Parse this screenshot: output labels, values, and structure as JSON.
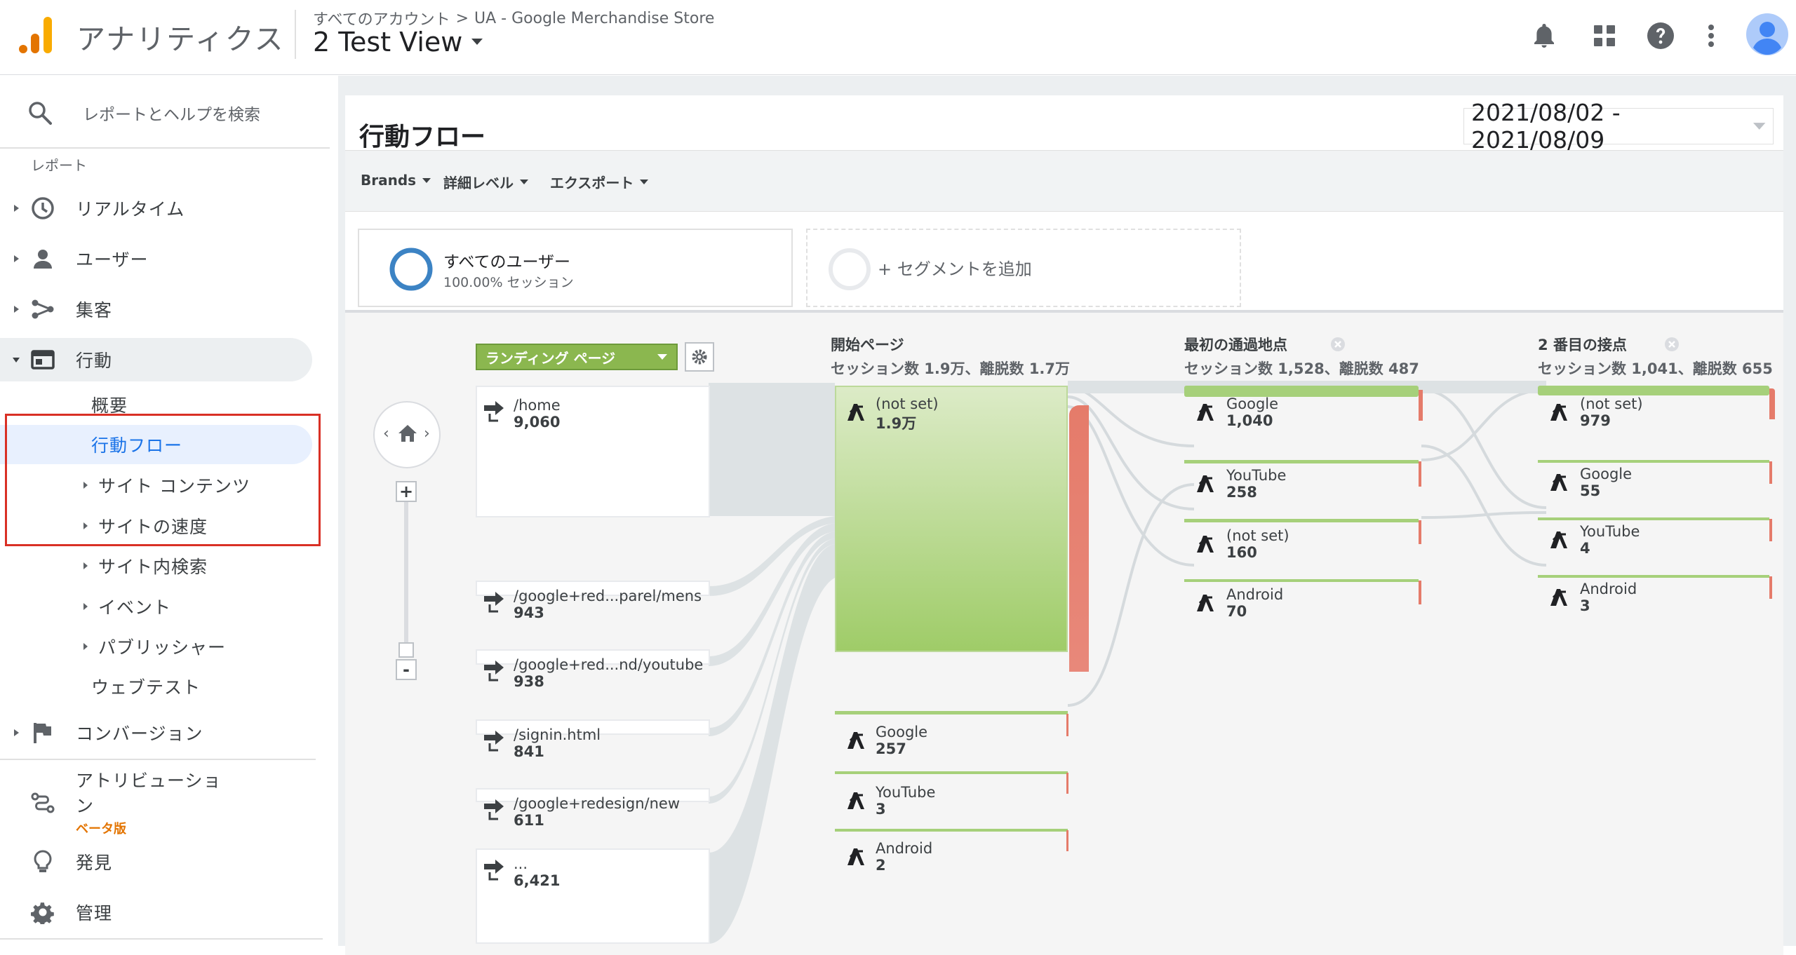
{
  "header": {
    "app_title": "アナリティクス",
    "breadcrumb_root": "すべてのアカウント",
    "breadcrumb_sep": ">",
    "breadcrumb_property": "UA - Google Merchandise Store",
    "view_title": "2 Test View"
  },
  "sidebar": {
    "search_placeholder": "レポートとヘルプを検索",
    "reports_header": "レポート",
    "items": [
      {
        "label": "リアルタイム",
        "icon": "clock-icon"
      },
      {
        "label": "ユーザー",
        "icon": "person-icon"
      },
      {
        "label": "集客",
        "icon": "acquisition-icon"
      },
      {
        "label": "行動",
        "icon": "behavior-icon"
      }
    ],
    "behavior_sub": [
      {
        "label": "概要"
      },
      {
        "label": "行動フロー"
      },
      {
        "label": "サイト コンテンツ"
      },
      {
        "label": "サイトの速度"
      },
      {
        "label": "サイト内検索"
      },
      {
        "label": "イベント"
      },
      {
        "label": "パブリッシャー"
      },
      {
        "label": "ウェブテスト"
      }
    ],
    "conversion": "コンバージョン",
    "attribution_line1": "アトリビューショ",
    "attribution_line2": "ン",
    "attribution_badge": "ベータ版",
    "discover": "発見",
    "admin": "管理"
  },
  "main": {
    "page_title": "行動フロー",
    "date_range": "2021/08/02 - 2021/08/09",
    "toolbar": {
      "brands": "Brands",
      "detail": "詳細レベル",
      "export": "エクスポート"
    },
    "segment_name": "すべてのユーザー",
    "segment_pct": "100.00% セッション",
    "add_segment": "+ セグメントを追加"
  },
  "flow": {
    "dimension_select": "ランディング ページ",
    "col_start": {
      "title": "開始ページ",
      "sub": "セッション数 1.9万、離脱数 1.7万"
    },
    "col_first": {
      "title": "最初の通過地点",
      "sub": "セッション数 1,528、離脱数 487"
    },
    "col_second": {
      "title": "2 番目の接点",
      "sub": "セッション数 1,041、離脱数 655"
    },
    "landing": [
      {
        "label": "/home",
        "value": "9,060"
      },
      {
        "label": "/google+red...parel/mens",
        "value": "943"
      },
      {
        "label": "/google+red...nd/youtube",
        "value": "938"
      },
      {
        "label": "/signin.html",
        "value": "841"
      },
      {
        "label": "/google+redesign/new",
        "value": "611"
      },
      {
        "label": "...",
        "value": "6,421"
      }
    ],
    "start": [
      {
        "label": "(not set)",
        "value": "1.9万"
      },
      {
        "label": "Google",
        "value": "257"
      },
      {
        "label": "YouTube",
        "value": "3"
      },
      {
        "label": "Android",
        "value": "2"
      }
    ],
    "first": [
      {
        "label": "Google",
        "value": "1,040"
      },
      {
        "label": "YouTube",
        "value": "258"
      },
      {
        "label": "(not set)",
        "value": "160"
      },
      {
        "label": "Android",
        "value": "70"
      }
    ],
    "second": [
      {
        "label": "(not set)",
        "value": "979"
      },
      {
        "label": "Google",
        "value": "55"
      },
      {
        "label": "YouTube",
        "value": "4"
      },
      {
        "label": "Android",
        "value": "3"
      }
    ],
    "zoom_plus": "+",
    "zoom_minus": "-"
  }
}
